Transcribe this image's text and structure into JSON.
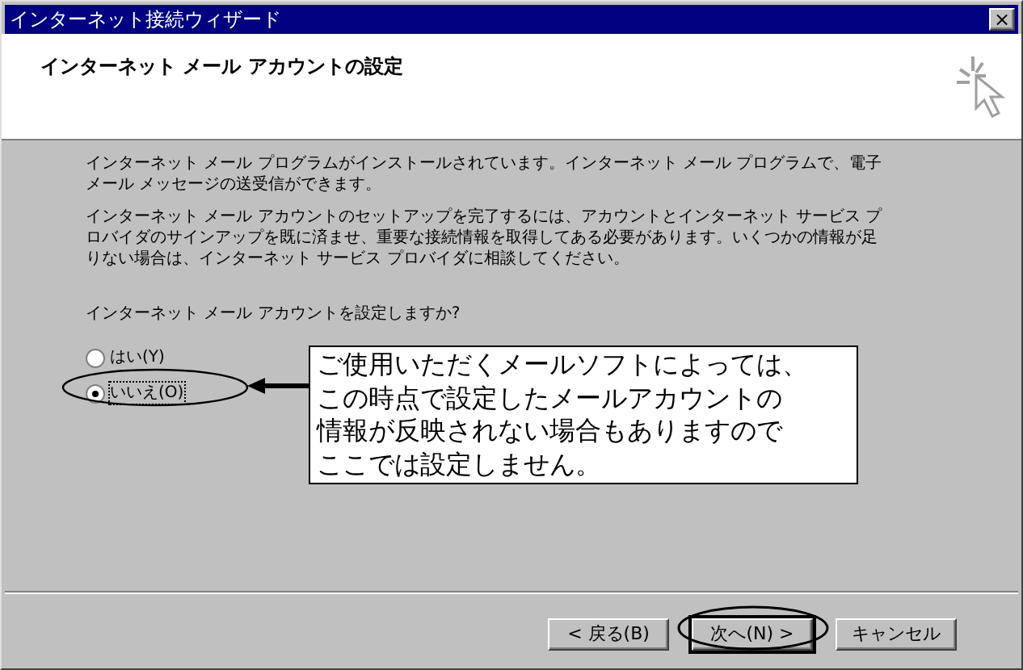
{
  "window": {
    "title": "インターネット接続ウィザード",
    "close": "×"
  },
  "header": {
    "title": "インターネット メール アカウントの設定"
  },
  "paragraphs": [
    "インターネット メール プログラムがインストールされています。インターネット メール プログラムで、電子メール メッセージの送受信ができます。",
    "インターネット メール アカウントのセットアップを完了するには、アカウントとインターネット サービス プロバイダのサインアップを既に済ませ、重要な接続情報を取得してある必要があります。いくつかの情報が足りない場合は、インターネット サービス プロバイダに相談してください。"
  ],
  "question": "インターネット メール アカウントを設定しますか?",
  "options": [
    {
      "label": "はい(Y)",
      "selected": false
    },
    {
      "label": "いいえ(O)",
      "selected": true
    }
  ],
  "callout": {
    "lines": [
      "ご使用いただくメールソフトによっては、",
      "この時点で設定したメールアカウントの",
      "情報が反映されない場合もありますので",
      "ここでは設定しません。"
    ]
  },
  "buttons": [
    {
      "label": "< 戻る(B)",
      "highlighted": false
    },
    {
      "label": "次へ(N) >",
      "highlighted": true
    },
    {
      "label": "キャンセル",
      "highlighted": false
    }
  ]
}
